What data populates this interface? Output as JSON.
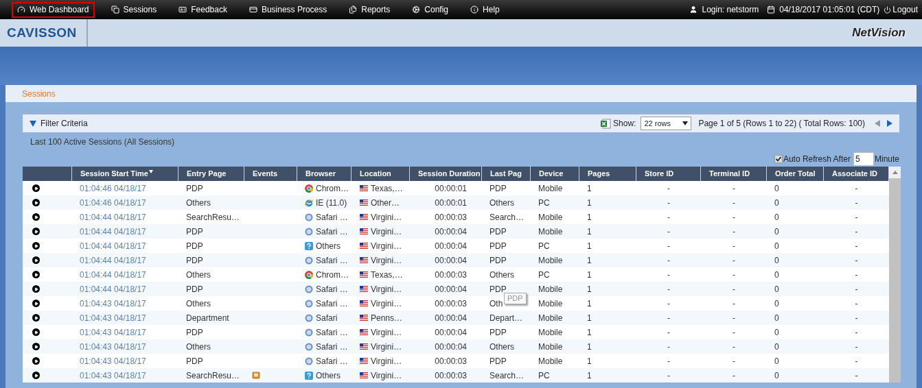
{
  "nav": {
    "items": [
      {
        "label": "Web Dashboard",
        "kind": "gauge",
        "selected": true
      },
      {
        "label": "Sessions",
        "kind": "copy",
        "selected": false
      },
      {
        "label": "Feedback",
        "kind": "card",
        "selected": false
      },
      {
        "label": "Business Process",
        "kind": "process",
        "selected": false
      },
      {
        "label": "Reports",
        "kind": "files",
        "selected": false
      },
      {
        "label": "Config",
        "kind": "cogs",
        "selected": false
      },
      {
        "label": "Help",
        "kind": "info",
        "selected": false
      }
    ],
    "login": "Login: netstorm",
    "datetime": "04/18/2017 01:05:01 (CDT)",
    "logout": "Logout"
  },
  "brand": {
    "logo": "CAVISSON",
    "product": "NetVision"
  },
  "panel": {
    "title": "Sessions",
    "filter": {
      "label": "Filter Criteria",
      "expanded": true,
      "show_label": "Show:",
      "rows_select": "22 rows",
      "pagination": "Page 1 of 5 (Rows 1 to 22) ( Total Rows: 100)"
    },
    "summary": "Last 100 Active Sessions (All Sessions)",
    "auto_refresh": {
      "checked": true,
      "label": "Auto Refresh After",
      "value": "5",
      "unit": "Minute"
    },
    "table": {
      "columns": [
        "Session Start Time",
        "Entry Page",
        "Events",
        "Browser",
        "Location",
        "Session Duration",
        "Last Pag",
        "Device",
        "Pages",
        "Store ID",
        "Terminal ID",
        "Order Total",
        "Associate ID"
      ],
      "rows": [
        {
          "start": "01:04:46 04/18/17",
          "entry": "PDP",
          "event": false,
          "browser": {
            "kind": "chrome",
            "label": "Chrom…"
          },
          "location": "Texas,…",
          "duration": "00:00:01",
          "last": "PDP",
          "device": "Mobile",
          "pages": "1",
          "store": "-",
          "terminal": "-",
          "order": "0",
          "associate": "-"
        },
        {
          "start": "01:04:46 04/18/17",
          "entry": "Others",
          "event": false,
          "browser": {
            "kind": "ie",
            "label": "IE (11.0)"
          },
          "location": "Other…",
          "duration": "00:00:01",
          "last": "Others",
          "device": "PC",
          "pages": "1",
          "store": "-",
          "terminal": "-",
          "order": "0",
          "associate": "-"
        },
        {
          "start": "01:04:44 04/18/17",
          "entry": "SearchResu…",
          "event": false,
          "browser": {
            "kind": "safari",
            "label": "Safari …"
          },
          "location": "Virgini…",
          "duration": "00:00:03",
          "last": "Search…",
          "device": "Mobile",
          "pages": "1",
          "store": "-",
          "terminal": "-",
          "order": "0",
          "associate": "-"
        },
        {
          "start": "01:04:44 04/18/17",
          "entry": "PDP",
          "event": false,
          "browser": {
            "kind": "safari",
            "label": "Safari …"
          },
          "location": "Virgini…",
          "duration": "00:00:04",
          "last": "PDP",
          "device": "Mobile",
          "pages": "1",
          "store": "-",
          "terminal": "-",
          "order": "0",
          "associate": "-"
        },
        {
          "start": "01:04:44 04/18/17",
          "entry": "PDP",
          "event": false,
          "browser": {
            "kind": "unknown",
            "label": "Others"
          },
          "location": "Virgini…",
          "duration": "00:00:04",
          "last": "PDP",
          "device": "PC",
          "pages": "1",
          "store": "-",
          "terminal": "-",
          "order": "0",
          "associate": "-"
        },
        {
          "start": "01:04:44 04/18/17",
          "entry": "PDP",
          "event": false,
          "browser": {
            "kind": "safari",
            "label": "Safari …"
          },
          "location": "Virgini…",
          "duration": "00:00:04",
          "last": "PDP",
          "device": "Mobile",
          "pages": "1",
          "store": "-",
          "terminal": "-",
          "order": "0",
          "associate": "-"
        },
        {
          "start": "01:04:44 04/18/17",
          "entry": "Others",
          "event": false,
          "browser": {
            "kind": "chrome",
            "label": "Chrom…"
          },
          "location": "Texas,…",
          "duration": "00:00:03",
          "last": "Others",
          "device": "PC",
          "pages": "1",
          "store": "-",
          "terminal": "-",
          "order": "0",
          "associate": "-"
        },
        {
          "start": "01:04:44 04/18/17",
          "entry": "PDP",
          "event": false,
          "browser": {
            "kind": "safari",
            "label": "Safari …"
          },
          "location": "Virgini…",
          "duration": "00:00:04",
          "last": "PDP",
          "device": "Mobile",
          "pages": "1",
          "store": "-",
          "terminal": "-",
          "order": "0",
          "associate": "-",
          "tooltip": "PDP"
        },
        {
          "start": "01:04:43 04/18/17",
          "entry": "Others",
          "event": false,
          "browser": {
            "kind": "safari",
            "label": "Safari …"
          },
          "location": "Virgini…",
          "duration": "00:00:03",
          "last": "Oth",
          "device": "Mobile",
          "pages": "1",
          "store": "-",
          "terminal": "-",
          "order": "0",
          "associate": "-"
        },
        {
          "start": "01:04:43 04/18/17",
          "entry": "Department",
          "event": false,
          "browser": {
            "kind": "safari",
            "label": "Safari"
          },
          "location": "Penns…",
          "duration": "00:00:04",
          "last": "Depart…",
          "device": "Mobile",
          "pages": "1",
          "store": "-",
          "terminal": "-",
          "order": "0",
          "associate": "-"
        },
        {
          "start": "01:04:43 04/18/17",
          "entry": "PDP",
          "event": false,
          "browser": {
            "kind": "safari",
            "label": "Safari …"
          },
          "location": "Virgini…",
          "duration": "00:00:04",
          "last": "PDP",
          "device": "Mobile",
          "pages": "1",
          "store": "-",
          "terminal": "-",
          "order": "0",
          "associate": "-"
        },
        {
          "start": "01:04:43 04/18/17",
          "entry": "Others",
          "event": false,
          "browser": {
            "kind": "safari",
            "label": "Safari …"
          },
          "location": "Virgini…",
          "duration": "00:00:04",
          "last": "Others",
          "device": "Mobile",
          "pages": "1",
          "store": "-",
          "terminal": "-",
          "order": "0",
          "associate": "-"
        },
        {
          "start": "01:04:43 04/18/17",
          "entry": "PDP",
          "event": false,
          "browser": {
            "kind": "safari",
            "label": "Safari …"
          },
          "location": "Virgini…",
          "duration": "00:00:03",
          "last": "PDP",
          "device": "Mobile",
          "pages": "1",
          "store": "-",
          "terminal": "-",
          "order": "0",
          "associate": "-"
        },
        {
          "start": "01:04:43 04/18/17",
          "entry": "SearchResu…",
          "event": true,
          "browser": {
            "kind": "unknown",
            "label": "Others"
          },
          "location": "Virgini…",
          "duration": "00:00:03",
          "last": "Search…",
          "device": "PC",
          "pages": "1",
          "store": "-",
          "terminal": "-",
          "order": "0",
          "associate": "-"
        }
      ]
    }
  }
}
